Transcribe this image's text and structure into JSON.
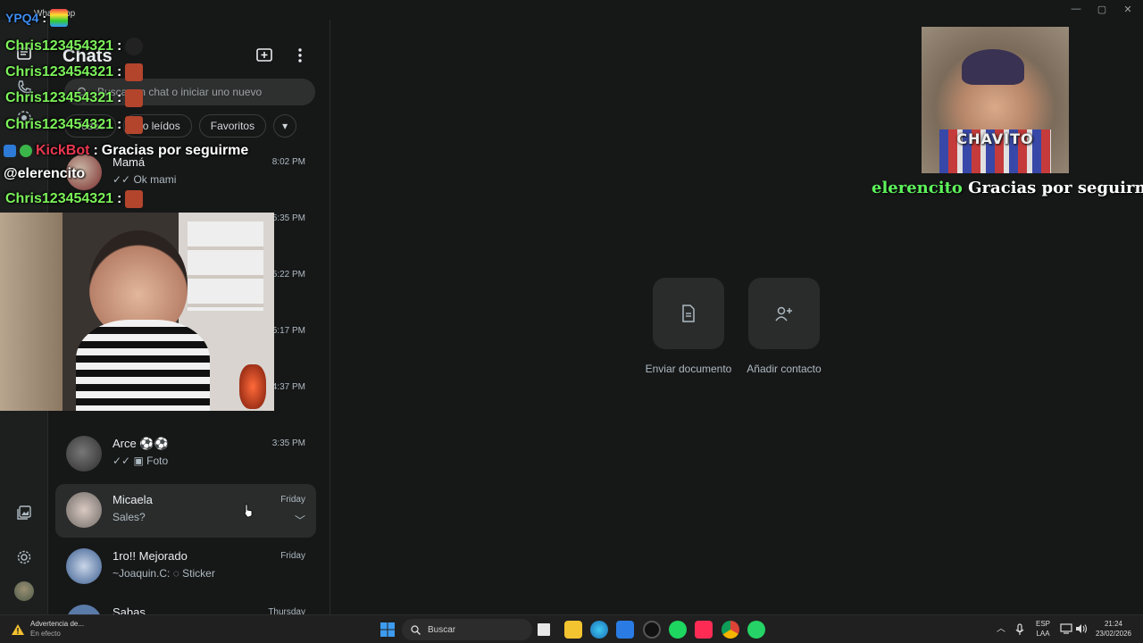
{
  "window": {
    "app_name": "WhatsApp",
    "controls": [
      "—",
      "▢",
      "✕"
    ]
  },
  "chats_panel": {
    "title": "Chats",
    "search_placeholder": "Buscar un chat o iniciar uno nuevo",
    "filters": [
      "Todos",
      "No leídos",
      "Favoritos"
    ],
    "chats": [
      {
        "name": "Mamá",
        "preview": "✓✓ Ok mami",
        "time": "8:02 PM"
      },
      {
        "name": "",
        "preview": "",
        "time": "5:35 PM"
      },
      {
        "name": "",
        "preview": "",
        "time": "5:22 PM"
      },
      {
        "name": "",
        "preview": "",
        "time": "5:17 PM"
      },
      {
        "name": "",
        "preview": "",
        "time": "4:37 PM"
      },
      {
        "name": "Arce ⚽⚽",
        "preview": "✓✓ ▣ Foto",
        "time": "3:35 PM"
      },
      {
        "name": "Micaela",
        "preview": "Sales?",
        "time": "Friday",
        "selected": true
      },
      {
        "name": "1ro!! Mejorado",
        "preview": "~Joaquin.C: ◌ Sticker",
        "time": "Friday"
      },
      {
        "name": "Sabas",
        "preview": "",
        "time": "Thursday"
      }
    ]
  },
  "main": {
    "actions": [
      {
        "label": "Enviar documento",
        "icon": "document-icon"
      },
      {
        "label": "Añadir contacto",
        "icon": "add-contact-icon"
      }
    ]
  },
  "stream_overlay": {
    "chat_lines": [
      {
        "user": "YPQ4",
        "sep": ":",
        "text": ""
      },
      {
        "user": "Chris123454321",
        "sep": ":",
        "text": ""
      },
      {
        "user": "Chris123454321",
        "sep": ":",
        "text": ""
      },
      {
        "user": "Chris123454321",
        "sep": ":",
        "text": ""
      },
      {
        "user": "Chris123454321",
        "sep": ":",
        "text": ""
      },
      {
        "user": "KickBot",
        "sep": ":",
        "text": "Gracias por seguirme"
      },
      {
        "user": "@elerencito",
        "sep": "",
        "text": ""
      },
      {
        "user": "Chris123454321",
        "sep": ":",
        "text": ""
      }
    ],
    "alert_name": "CHAVITO",
    "alert_user": "elerencito",
    "alert_message": "Gracias por seguirme!!"
  },
  "taskbar": {
    "notification_title": "Advertencia de...",
    "notification_sub": "En efecto",
    "search_label": "Buscar",
    "lang_top": "ESP",
    "lang_bottom": "LAA",
    "time": "21:24",
    "date": "23/02/2026"
  }
}
